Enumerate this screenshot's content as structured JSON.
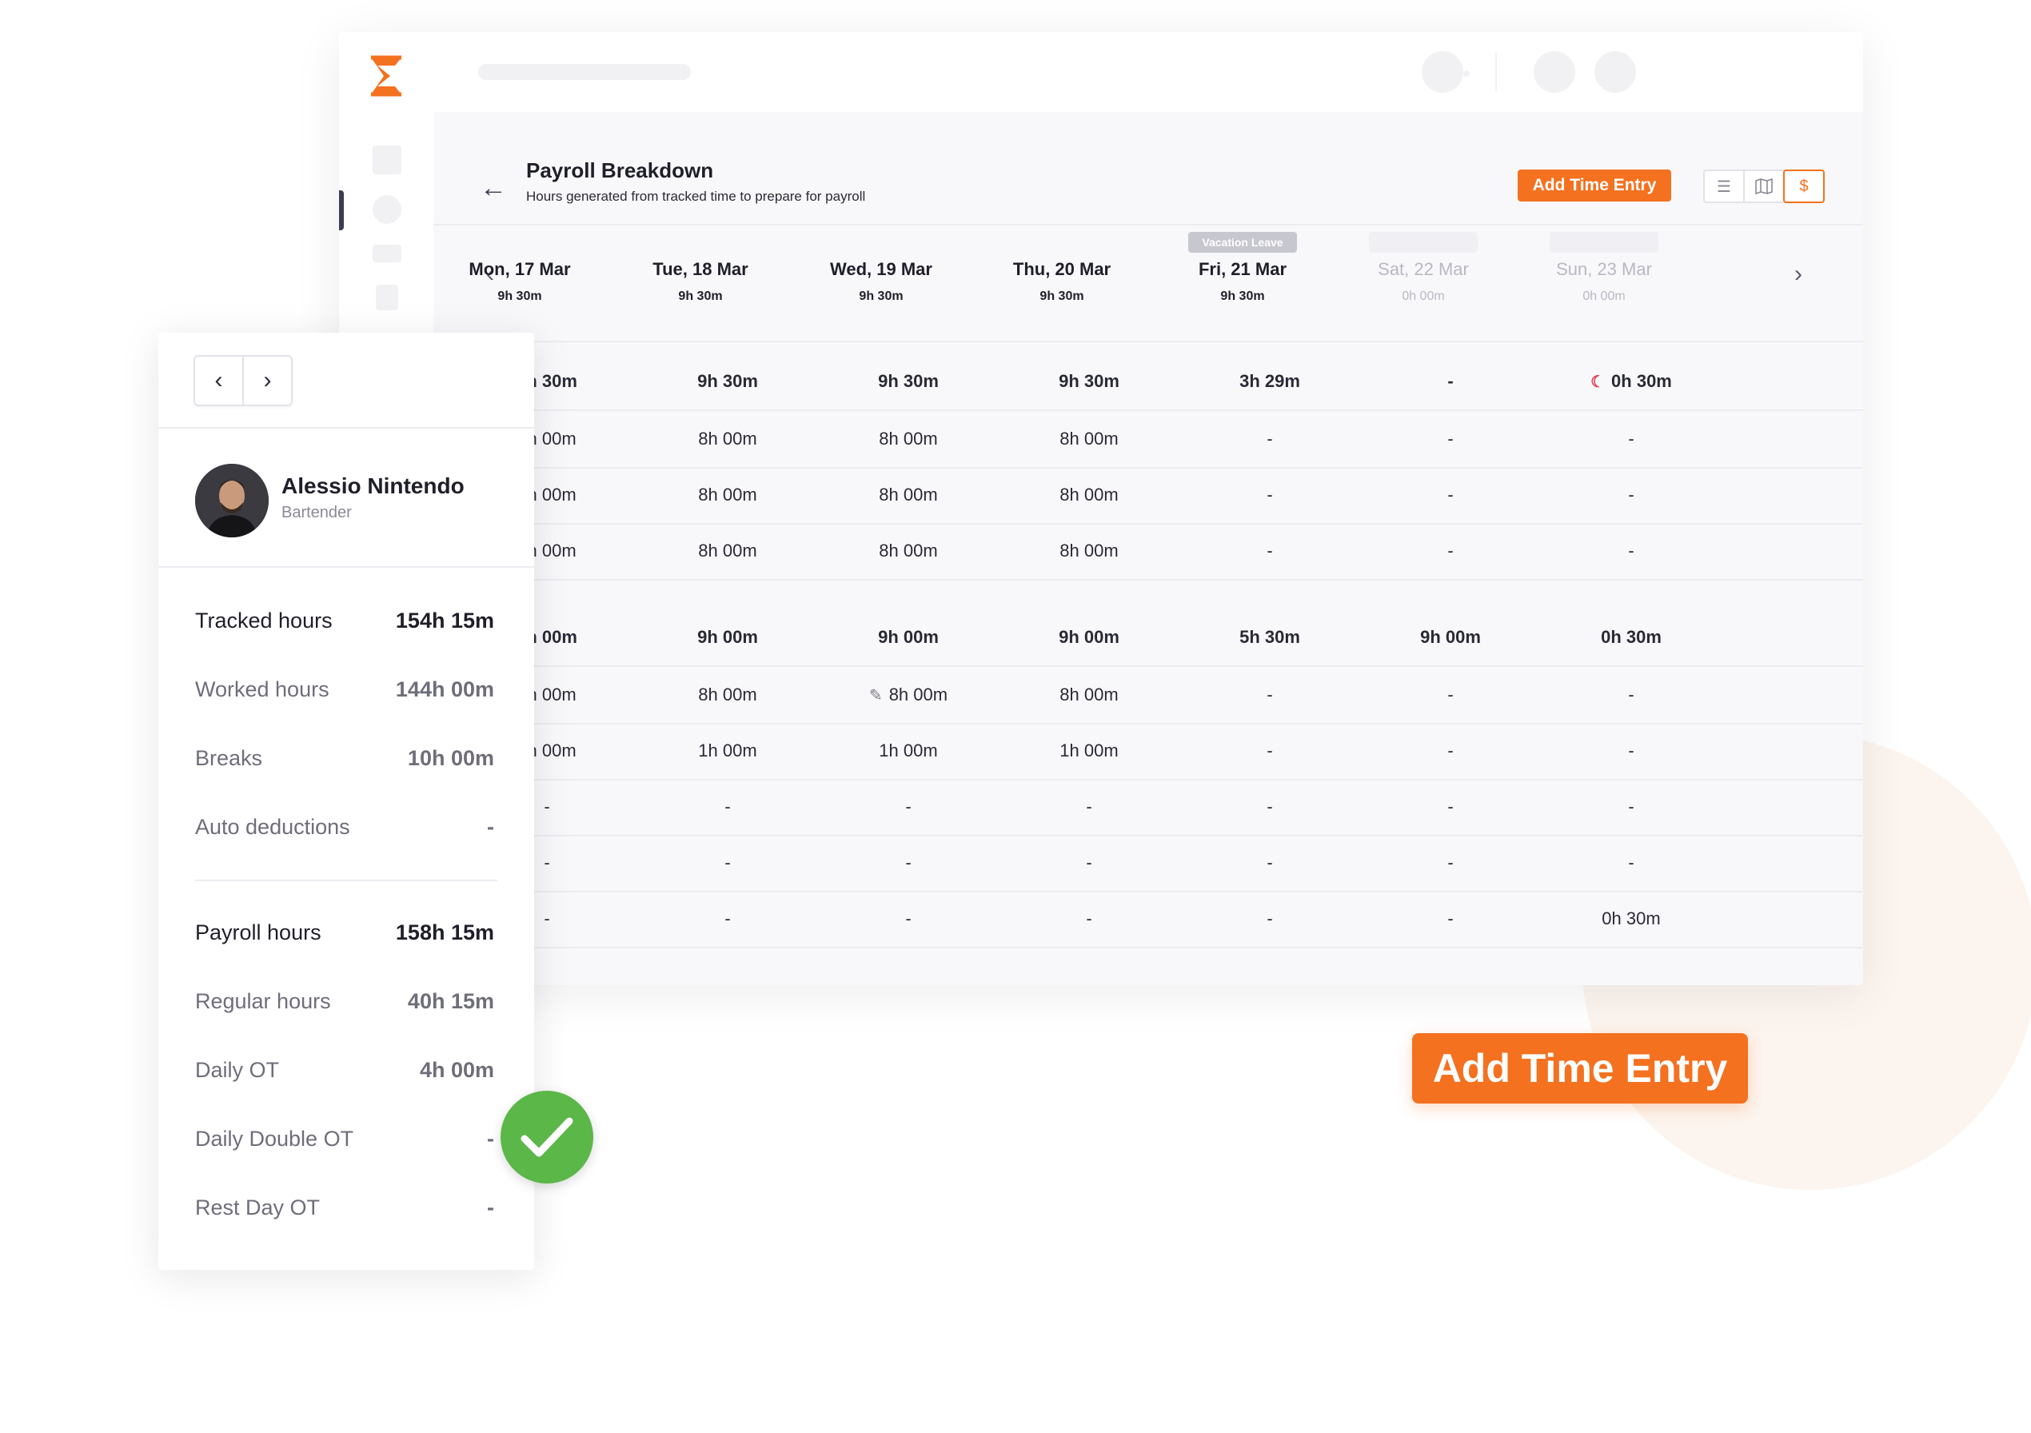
{
  "page": {
    "title": "Payroll Breakdown",
    "subtitle": "Hours generated from tracked time to prepare for payroll",
    "add_entry_label": "Add Time Entry",
    "back_icon": "arrow-left-icon",
    "view_icons": [
      "list-icon",
      "map-icon",
      "dollar-icon"
    ],
    "accent_color": "#f47120"
  },
  "days": [
    {
      "name": "Mon, 17 Mar",
      "total": "9h 30m",
      "badge": ""
    },
    {
      "name": "Tue, 18 Mar",
      "total": "9h 30m",
      "badge": ""
    },
    {
      "name": "Wed, 19 Mar",
      "total": "9h 30m",
      "badge": ""
    },
    {
      "name": "Thu, 20 Mar",
      "total": "9h 30m",
      "badge": ""
    },
    {
      "name": "Fri, 21 Mar",
      "total": "9h 30m",
      "badge": "Vacation Leave"
    },
    {
      "name": "Sat, 22 Mar",
      "total": "0h 00m",
      "badge": ""
    },
    {
      "name": "Sun, 23 Mar",
      "total": "0h 00m",
      "badge": ""
    }
  ],
  "rows": [
    {
      "bold": true,
      "cells": [
        "9h 30m",
        "9h 30m",
        "9h 30m",
        "9h 30m",
        "3h 29m",
        "-",
        "0h 30m"
      ]
    },
    {
      "bold": false,
      "cells": [
        "8h 00m",
        "8h 00m",
        "8h 00m",
        "8h 00m",
        "-",
        "-",
        "-"
      ]
    },
    {
      "bold": false,
      "cells": [
        "8h 00m",
        "8h 00m",
        "8h 00m",
        "8h 00m",
        "-",
        "-",
        "-"
      ]
    },
    {
      "bold": false,
      "cells": [
        "8h 00m",
        "8h 00m",
        "8h 00m",
        "8h 00m",
        "-",
        "-",
        "-"
      ]
    },
    {
      "bold": true,
      "cells": [
        "9h 00m",
        "9h 00m",
        "9h 00m",
        "9h 00m",
        "5h 30m",
        "9h 00m",
        "0h 30m"
      ]
    },
    {
      "bold": false,
      "cells": [
        "8h 00m",
        "8h 00m",
        "8h 00m",
        "8h 00m",
        "-",
        "-",
        "-"
      ]
    },
    {
      "bold": false,
      "cells": [
        "1h 00m",
        "1h 00m",
        "1h 00m",
        "1h 00m",
        "-",
        "-",
        "-"
      ]
    },
    {
      "bold": false,
      "cells": [
        "-",
        "-",
        "-",
        "-",
        "-",
        "-",
        "-"
      ]
    },
    {
      "bold": false,
      "cells": [
        "-",
        "-",
        "-",
        "-",
        "-",
        "-",
        "-"
      ]
    },
    {
      "bold": false,
      "cells": [
        "-",
        "-",
        "-",
        "-",
        "-",
        "-",
        "0h 30m"
      ]
    }
  ],
  "employee": {
    "name": "Alessio Nintendo",
    "role": "Bartender"
  },
  "stats_tracked": [
    {
      "label": "Tracked hours",
      "value": "154h 15m"
    },
    {
      "label": "Worked hours",
      "value": "144h 00m"
    },
    {
      "label": "Breaks",
      "value": "10h 00m"
    },
    {
      "label": "Auto deductions",
      "value": "-"
    }
  ],
  "stats_payroll": [
    {
      "label": "Payroll hours",
      "value": "158h 15m"
    },
    {
      "label": "Regular hours",
      "value": "40h 15m"
    },
    {
      "label": "Daily OT",
      "value": "4h 00m"
    },
    {
      "label": "Daily Double OT",
      "value": "-"
    },
    {
      "label": "Rest Day OT",
      "value": "-"
    }
  ],
  "cta": {
    "label": "Add Time Entry"
  }
}
